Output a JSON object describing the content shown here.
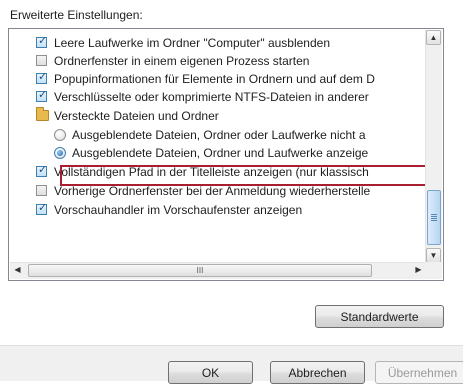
{
  "section_label": "Erweiterte Einstellungen:",
  "items": [
    {
      "type": "checkbox",
      "checked": true,
      "label": "Leere Laufwerke im Ordner \"Computer\" ausblenden"
    },
    {
      "type": "checkbox",
      "checked": false,
      "label": "Ordnerfenster in einem eigenen Prozess starten"
    },
    {
      "type": "checkbox",
      "checked": true,
      "label": "Popupinformationen für Elemente in Ordnern und auf dem D"
    },
    {
      "type": "checkbox",
      "checked": true,
      "label": "Verschlüsselte oder komprimierte NTFS-Dateien in anderer"
    },
    {
      "type": "folder",
      "label": "Versteckte Dateien und Ordner"
    },
    {
      "type": "radio",
      "selected": false,
      "label": "Ausgeblendete Dateien, Ordner oder Laufwerke nicht a"
    },
    {
      "type": "radio",
      "selected": true,
      "label": "Ausgeblendete Dateien, Ordner und Laufwerke anzeige"
    },
    {
      "type": "checkbox",
      "checked": true,
      "label": "Vollständigen Pfad in der Titelleiste anzeigen (nur klassisch"
    },
    {
      "type": "checkbox",
      "checked": false,
      "label": "Vorherige Ordnerfenster bei der Anmeldung wiederherstelle"
    },
    {
      "type": "checkbox",
      "checked": true,
      "label": "Vorschauhandler im Vorschaufenster anzeigen"
    }
  ],
  "buttons": {
    "restore_defaults": "Standardwerte",
    "ok": "OK",
    "cancel": "Abbrechen",
    "apply": "Übernehmen"
  },
  "icons": {
    "tick": "✓",
    "scroll_up": "▲",
    "scroll_down": "▼",
    "scroll_left": "◀",
    "scroll_right": "▶",
    "hthumb_grip": "III"
  },
  "colors": {
    "highlight_border": "#a8202f",
    "selection_accent": "#3c7fb1"
  }
}
